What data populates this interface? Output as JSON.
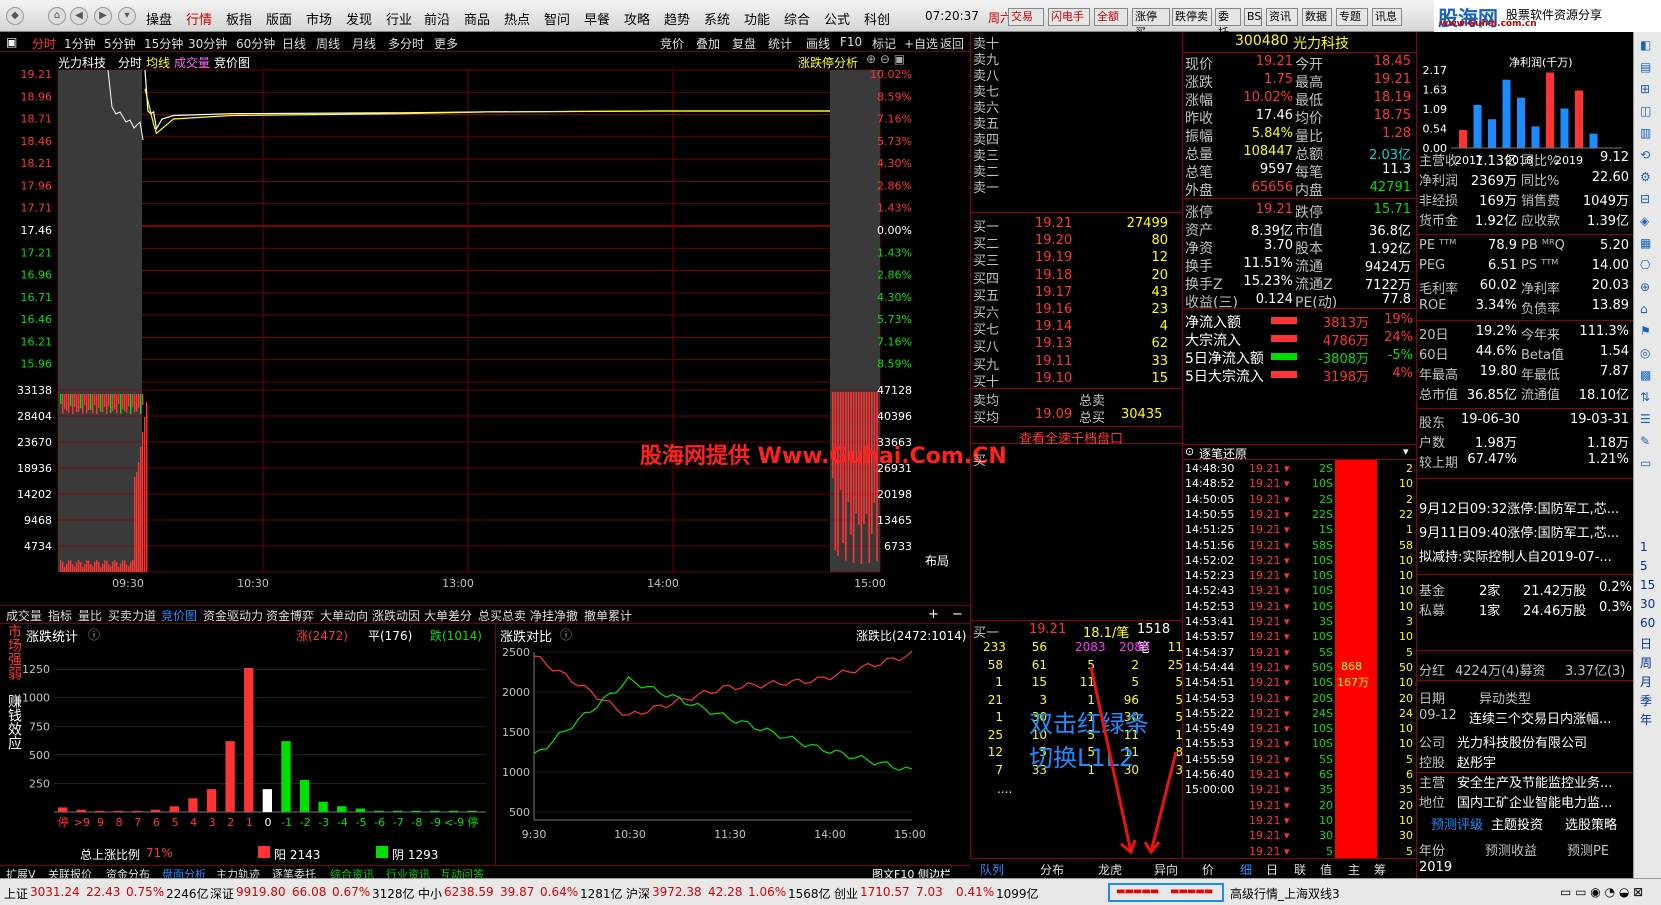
{
  "menu": {
    "items": [
      "操盘",
      "行情",
      "板指",
      "版面",
      "市场",
      "发现",
      "行业",
      "前沿",
      "商品",
      "热点",
      "智问",
      "早餐",
      "攻略",
      "趋势",
      "系统",
      "功能",
      "综合",
      "公式",
      "科创"
    ],
    "time": "07:20:37",
    "weekday": "周六",
    "trade_buttons": [
      "交易",
      "闪电手",
      "全额",
      "涨停买",
      "跌停卖",
      "委托",
      "BS",
      "资讯",
      "数据",
      "专题",
      "讯息"
    ],
    "logo": "股海网",
    "logo_sub": "股票软件资源分享",
    "logo_url": "www.Guhai.com.cn"
  },
  "period_bar": {
    "items": [
      "分时",
      "1分钟",
      "5分钟",
      "15分钟",
      "30分钟",
      "60分钟",
      "日线",
      "周线",
      "月线",
      "多分时",
      "更多"
    ],
    "right_items": [
      "竞价",
      "叠加",
      "复盘",
      "统计",
      "画线",
      "F10",
      "标记",
      "+自选",
      "返回"
    ]
  },
  "chart_header": {
    "stock_name": "光力科技",
    "mode": "分时",
    "avg_line": "均线",
    "volume": "成交量",
    "auction": "竞价图",
    "analysis": "涨跌停分析"
  },
  "price_axis": {
    "left": [
      "19.21",
      "18.96",
      "18.71",
      "18.46",
      "18.21",
      "17.96",
      "17.71",
      "17.46",
      "17.21",
      "16.96",
      "16.71",
      "16.46",
      "16.21",
      "15.96"
    ],
    "right": [
      "10.02%",
      "8.59%",
      "7.16%",
      "5.73%",
      "4.30%",
      "2.86%",
      "1.43%",
      "0.00%",
      "1.43%",
      "2.86%",
      "4.30%",
      "5.73%",
      "7.16%",
      "8.59%"
    ]
  },
  "volume_axis": {
    "left": [
      "33138",
      "28404",
      "23670",
      "18936",
      "14202",
      "9468",
      "4734"
    ],
    "right": [
      "47128",
      "40396",
      "33663",
      "26931",
      "20198",
      "13465",
      "6733"
    ]
  },
  "time_axis": [
    "09:30",
    "10:30",
    "13:00",
    "14:00",
    "15:00"
  ],
  "layout_btn": "布局",
  "chart_data": [
    {
      "type": "line",
      "title": "",
      "series": [
        {
          "name": "价格",
          "x": [
            "09:30",
            "09:31",
            "09:32",
            "09:33",
            "09:34",
            "09:36",
            "09:40",
            "10:00",
            "11:00",
            "13:00",
            "14:00",
            "15:00"
          ],
          "values": [
            19.21,
            18.75,
            18.72,
            18.74,
            18.55,
            18.66,
            18.7,
            18.72,
            18.73,
            18.74,
            18.75,
            18.75
          ]
        },
        {
          "name": "均线",
          "x": [
            "09:30",
            "09:33",
            "09:34",
            "09:40",
            "10:00",
            "11:00",
            "13:00",
            "14:00",
            "15:00"
          ],
          "values": [
            19.0,
            18.6,
            18.5,
            18.66,
            18.7,
            18.72,
            18.74,
            18.75,
            18.75
          ]
        }
      ],
      "ylim": [
        15.71,
        19.21
      ]
    },
    {
      "type": "bar",
      "title": "涨跌统计",
      "categories": [
        "停",
        ">9",
        "9",
        "8",
        "7",
        "6",
        "5",
        "4",
        "3",
        "2",
        "1",
        "0",
        "-1",
        "-2",
        "-3",
        "-4",
        "-5",
        "-6",
        "-7",
        "-8",
        "-9",
        "<-9",
        "停"
      ],
      "values": [
        40,
        20,
        10,
        10,
        10,
        20,
        50,
        120,
        200,
        620,
        1260,
        200,
        620,
        280,
        90,
        50,
        30,
        10,
        10,
        10,
        10,
        10,
        10
      ],
      "ylim": [
        0,
        1400
      ]
    },
    {
      "type": "line",
      "title": "涨跌对比",
      "x": [
        "9:30",
        "10:30",
        "11:30",
        "14:00",
        "15:00"
      ],
      "series": [
        {
          "name": "涨",
          "values": [
            2450,
            1700,
            2050,
            2150,
            2472
          ]
        },
        {
          "name": "跌",
          "values": [
            1200,
            2150,
            1700,
            1300,
            1014
          ]
        }
      ],
      "ylim": [
        500,
        2500
      ]
    }
  ],
  "bottom_tabs": [
    "成交量",
    "指标",
    "量比",
    "买卖力道",
    "竞价图",
    "资金驱动力",
    "资金博弈",
    "大单动向",
    "涨跌动因",
    "大单差分",
    "总买总卖",
    "净挂净撤",
    "撤单累计"
  ],
  "stats_panel": {
    "label_vertical": "市场强弱",
    "label_vertical2": "赚钱效应",
    "title": "涨跌统计",
    "up_label": "涨(2472)",
    "flat_label": "平(176)",
    "down_label": "跌(1014)",
    "y_ticks": [
      "1250",
      "1000",
      "750",
      "500",
      "250"
    ],
    "x_labels": [
      "停",
      ">9",
      "9",
      "8",
      "7",
      "6",
      "5",
      "4",
      "3",
      "2",
      "1",
      "0",
      "-1",
      "-2",
      "-3",
      "-4",
      "-5",
      "-6",
      "-7",
      "-8",
      "-9",
      "<-9",
      "停"
    ],
    "ratio_label": "总上涨比例",
    "ratio_value": "71%",
    "yang_label": "阳 2143",
    "yin_label": "阴 1293"
  },
  "compare_panel": {
    "title": "涨跌对比",
    "ratio": "涨跌比(2472:1014)",
    "y_ticks": [
      "2500",
      "2000",
      "1500",
      "1000",
      "500"
    ],
    "x_labels": [
      "9:30",
      "10:30",
      "11:30",
      "14:00",
      "15:00"
    ]
  },
  "watermark": "股海网提供 Www.Guhai.Com.CN",
  "bottom_tabs2": [
    "扩展V",
    "关联报价",
    "资金分布",
    "盘面分析",
    "主力轨迹",
    "逐笔委托",
    "综合资讯",
    "行业资讯",
    "互动问答"
  ],
  "f10_btn": "图文F10",
  "side_btn": "侧边栏",
  "orderbook": {
    "sell": [
      "卖十",
      "卖九",
      "卖八",
      "卖七",
      "卖六",
      "卖五",
      "卖四",
      "卖三",
      "卖二",
      "卖一"
    ],
    "buy": [
      {
        "label": "买一",
        "price": "19.21",
        "vol": "27499"
      },
      {
        "label": "买二",
        "price": "19.20",
        "vol": "80"
      },
      {
        "label": "买三",
        "price": "19.19",
        "vol": "12"
      },
      {
        "label": "买四",
        "price": "19.18",
        "vol": "20"
      },
      {
        "label": "买五",
        "price": "19.17",
        "vol": "43"
      },
      {
        "label": "买六",
        "price": "19.16",
        "vol": "23"
      },
      {
        "label": "买七",
        "price": "19.14",
        "vol": "4"
      },
      {
        "label": "买八",
        "price": "19.13",
        "vol": "62"
      },
      {
        "label": "买九",
        "price": "19.11",
        "vol": "33"
      },
      {
        "label": "买十",
        "price": "19.10",
        "vol": "15"
      }
    ],
    "sell_avg_label": "卖均",
    "sell_total_label": "总卖",
    "buy_avg_label": "买均",
    "buy_avg": "19.09",
    "buy_total_label": "总买",
    "buy_total": "30435",
    "full_btn": "查看全速千档盘口",
    "buy_side": "买",
    "queue_header": {
      "label": "买一",
      "price": "19.21",
      "per": "18.1/笔",
      "count": "1518笔"
    },
    "queue": [
      [
        "233",
        "56",
        "2083",
        "2089",
        "11"
      ],
      [
        "58",
        "61",
        "5",
        "2",
        "25"
      ],
      [
        "1",
        "15",
        "11",
        "5",
        "5"
      ],
      [
        "21",
        "3",
        "1",
        "96",
        "5"
      ],
      [
        "1",
        "30",
        "1",
        "30",
        "5"
      ],
      [
        "25",
        "10",
        "5",
        "11",
        "1"
      ],
      [
        "12",
        "5",
        "5",
        "11",
        "8"
      ],
      [
        "7",
        "33",
        "1",
        "30",
        "3"
      ]
    ],
    "dots": "....",
    "annotation1": "双击红绿条",
    "annotation2": "切换L1L2"
  },
  "quote": {
    "code": "300480",
    "name": "光力科技",
    "rows": [
      [
        {
          "l": "现价",
          "v": "19.21",
          "c": "red"
        },
        {
          "l": "今开",
          "v": "18.45",
          "c": "red"
        }
      ],
      [
        {
          "l": "涨跌",
          "v": "1.75",
          "c": "red"
        },
        {
          "l": "最高",
          "v": "19.21",
          "c": "red"
        }
      ],
      [
        {
          "l": "涨幅",
          "v": "10.02%",
          "c": "red"
        },
        {
          "l": "最低",
          "v": "18.19",
          "c": "red"
        }
      ],
      [
        {
          "l": "昨收",
          "v": "17.46",
          "c": "white"
        },
        {
          "l": "均价",
          "v": "18.75",
          "c": "red"
        }
      ],
      [
        {
          "l": "振幅",
          "v": "5.84%",
          "c": "yellow"
        },
        {
          "l": "量比",
          "v": "1.28",
          "c": "red"
        }
      ],
      [
        {
          "l": "总量",
          "v": "108447",
          "c": "yellow"
        },
        {
          "l": "总额",
          "v": "2.03亿",
          "c": "cyan"
        }
      ],
      [
        {
          "l": "总笔",
          "v": "9597",
          "c": "white"
        },
        {
          "l": "每笔",
          "v": "11.3",
          "c": "white"
        }
      ],
      [
        {
          "l": "外盘",
          "v": "65656",
          "c": "red"
        },
        {
          "l": "内盘",
          "v": "42791",
          "c": "green"
        }
      ],
      [
        {
          "l": "涨停",
          "v": "19.21",
          "c": "red"
        },
        {
          "l": "跌停",
          "v": "15.71",
          "c": "green"
        }
      ],
      [
        {
          "l": "资产",
          "v": "8.39亿",
          "c": "white"
        },
        {
          "l": "市值",
          "v": "36.8亿",
          "c": "white"
        }
      ],
      [
        {
          "l": "净资",
          "v": "3.70",
          "c": "white"
        },
        {
          "l": "股本",
          "v": "1.92亿",
          "c": "white"
        }
      ],
      [
        {
          "l": "换手",
          "v": "11.51%",
          "c": "white"
        },
        {
          "l": "流通",
          "v": "9424万",
          "c": "white"
        }
      ],
      [
        {
          "l": "换手Z",
          "v": "15.23%",
          "c": "white"
        },
        {
          "l": "流通Z",
          "v": "7122万",
          "c": "white"
        }
      ],
      [
        {
          "l": "收益(三)",
          "v": "0.124",
          "c": "white"
        },
        {
          "l": "PE(动)",
          "v": "77.8",
          "c": "white"
        }
      ]
    ],
    "flows": [
      {
        "l": "净流入额",
        "v": "3813万",
        "p": "19%",
        "c": "red",
        "bar": "red"
      },
      {
        "l": "大宗流入",
        "v": "4786万",
        "p": "24%",
        "c": "red",
        "bar": "red"
      },
      {
        "l": "5日净流入额",
        "v": "-3808万",
        "p": "-5%",
        "c": "green",
        "bar": "green"
      },
      {
        "l": "5日大宗流入",
        "v": "3198万",
        "p": "4%",
        "c": "red",
        "bar": "red"
      }
    ],
    "ticks_title": "逐笔还原",
    "ticks": [
      [
        "14:48:30",
        "19.21",
        "2S",
        "2"
      ],
      [
        "14:48:52",
        "19.21",
        "10S",
        "10"
      ],
      [
        "14:50:05",
        "19.21",
        "2S",
        "2"
      ],
      [
        "14:50:55",
        "19.21",
        "22S",
        "22"
      ],
      [
        "14:51:25",
        "19.21",
        "1S",
        "1"
      ],
      [
        "14:51:56",
        "19.21",
        "58S",
        "58"
      ],
      [
        "14:52:02",
        "19.21",
        "10S",
        "10"
      ],
      [
        "14:52:23",
        "19.21",
        "10S",
        "10"
      ],
      [
        "14:52:43",
        "19.21",
        "10S",
        "10"
      ],
      [
        "14:52:53",
        "19.21",
        "10S",
        "10"
      ],
      [
        "14:53:41",
        "19.21",
        "3S",
        "3"
      ],
      [
        "14:53:57",
        "19.21",
        "10S",
        "10"
      ],
      [
        "14:54:37",
        "19.21",
        "5S",
        "5"
      ],
      [
        "14:54:44",
        "19.21",
        "50S",
        "50"
      ],
      [
        "14:54:51",
        "19.21",
        "10S",
        "10"
      ],
      [
        "14:54:53",
        "19.21",
        "20S",
        "20"
      ],
      [
        "14:55:22",
        "19.21",
        "24S",
        "24"
      ],
      [
        "14:55:49",
        "19.21",
        "10S",
        "10"
      ],
      [
        "14:55:53",
        "19.21",
        "10S",
        "10"
      ],
      [
        "14:55:59",
        "19.21",
        "5S",
        "5"
      ],
      [
        "14:56:40",
        "19.21",
        "6S",
        "6"
      ],
      [
        "15:00:00",
        "19.21",
        "35",
        "35"
      ],
      [
        "",
        "19.21",
        "20",
        "20"
      ],
      [
        "",
        "19.21",
        "10",
        "10"
      ],
      [
        "",
        "19.21",
        "30",
        "30"
      ],
      [
        "",
        "19.21",
        "5",
        "5"
      ],
      [
        "",
        "19.21",
        "50",
        "50"
      ]
    ],
    "big_bar_vol": "868",
    "big_bar_amt": "167万",
    "bottom_tabs": [
      "队列",
      "分布",
      "龙虎",
      "异向",
      "价",
      "细",
      "日",
      "联",
      "值",
      "主",
      "筹"
    ]
  },
  "finance": {
    "chart_title": "净利润(千万)",
    "y_ticks": [
      "2.17",
      "1.63",
      "1.09",
      "0.54",
      "0.00"
    ],
    "years": [
      "2017",
      "2018",
      "2019"
    ],
    "bars": [
      0.5,
      1.2,
      0.8,
      1.9,
      1.4,
      0.6,
      2.1,
      1.1,
      1.6,
      0.4
    ],
    "rows": [
      [
        {
          "l": "主营收",
          "v": "1.13亿"
        },
        {
          "l": "同比%",
          "v": "9.12"
        }
      ],
      [
        {
          "l": "净利润",
          "v": "2369万"
        },
        {
          "l": "同比%",
          "v": "22.60"
        }
      ],
      [
        {
          "l": "非经损",
          "v": "169万"
        },
        {
          "l": "销售费",
          "v": "1049万"
        }
      ],
      [
        {
          "l": "货币金",
          "v": "1.92亿"
        },
        {
          "l": "应收款",
          "v": "1.39亿"
        }
      ],
      [
        {
          "l": "PE ᵀᵀᴹ",
          "v": "78.9"
        },
        {
          "l": "PB ᴹᴿQ",
          "v": "5.20"
        }
      ],
      [
        {
          "l": "PEG",
          "v": "6.51"
        },
        {
          "l": "PS ᵀᵀᴹ",
          "v": "14.00"
        }
      ],
      [
        {
          "l": "毛利率",
          "v": "60.02"
        },
        {
          "l": "净利率",
          "v": "20.03"
        }
      ],
      [
        {
          "l": "ROE",
          "v": "3.34%"
        },
        {
          "l": "负债率",
          "v": "13.89"
        }
      ],
      [
        {
          "l": "20日",
          "v": "19.2%"
        },
        {
          "l": "今年来",
          "v": "111.3%"
        }
      ],
      [
        {
          "l": "60日",
          "v": "44.6%"
        },
        {
          "l": "Beta值",
          "v": "1.54"
        }
      ],
      [
        {
          "l": "年最高",
          "v": "19.80"
        },
        {
          "l": "年最低",
          "v": "7.87"
        }
      ],
      [
        {
          "l": "总市值",
          "v": "36.85亿"
        },
        {
          "l": "流通值",
          "v": "18.10亿"
        }
      ],
      [
        {
          "l": "股东",
          "v": "19-06-30"
        },
        {
          "l": "",
          "v": "19-03-31"
        }
      ],
      [
        {
          "l": "户数",
          "v": "1.98万"
        },
        {
          "l": "",
          "v": "1.18万"
        }
      ],
      [
        {
          "l": "较上期",
          "v": "67.47%"
        },
        {
          "l": "",
          "v": "1.21%"
        }
      ]
    ],
    "news": [
      "9月12日09:32涨停:国防军工,芯...",
      "9月11日09:40涨停:国防军工,芯...",
      "拟减持:实际控制人自2019-07-..."
    ],
    "holders": [
      {
        "l": "基金",
        "c": "2家",
        "s": "21.42万股",
        "p": "0.2%"
      },
      {
        "l": "私募",
        "c": "1家",
        "s": "24.46万股",
        "p": "0.3%"
      }
    ],
    "dividend": {
      "l": "分红",
      "v": "4224万(4)募资",
      "v2": "3.37亿(3)"
    },
    "events": {
      "date_h": "日期",
      "type_h": "异动类型",
      "date": "09-12",
      "type": "连续三个交易日内涨幅..."
    },
    "company": [
      {
        "l": "公司",
        "v": "光力科技股份有限公司"
      },
      {
        "l": "控股",
        "v": "赵彤宇"
      },
      {
        "l": "主营",
        "v": "安全生产及节能监控业务..."
      },
      {
        "l": "地位",
        "v": "国内工矿企业智能电力监..."
      }
    ],
    "forecast_tabs": [
      "预测评级",
      "主题投资",
      "选股策略"
    ],
    "forecast_head": [
      "年份",
      "预测收益",
      "预测PE"
    ],
    "forecast_years": [
      "2019",
      "2020"
    ]
  },
  "sidebar_right": {
    "labels": [
      "1",
      "5",
      "15",
      "30",
      "60",
      "日",
      "周",
      "月",
      "季",
      "年"
    ]
  },
  "status": {
    "items": [
      {
        "name": "上证",
        "v": "3031.24",
        "c": "22.43",
        "p": "0.75%",
        "a": "2246亿"
      },
      {
        "name": "深证",
        "v": "9919.80",
        "c": "66.08",
        "p": "0.67%",
        "a": "3128亿"
      },
      {
        "name": "中小",
        "v": "6238.59",
        "c": "39.87",
        "p": "0.64%",
        "a": "1281亿"
      },
      {
        "name": "沪深",
        "v": "3972.38",
        "c": "42.28",
        "p": "1.06%",
        "a": "1568亿"
      },
      {
        "name": "创业",
        "v": "1710.57",
        "c": "7.03",
        "p": "0.41%",
        "a": "1099亿"
      }
    ],
    "right_text": "高级行情_上海双线3"
  },
  "colors": {
    "up": "#ff3333",
    "down": "#00e000",
    "grid": "#8b0000",
    "price_line": "#ffffff",
    "avg_line": "#ffff00"
  }
}
